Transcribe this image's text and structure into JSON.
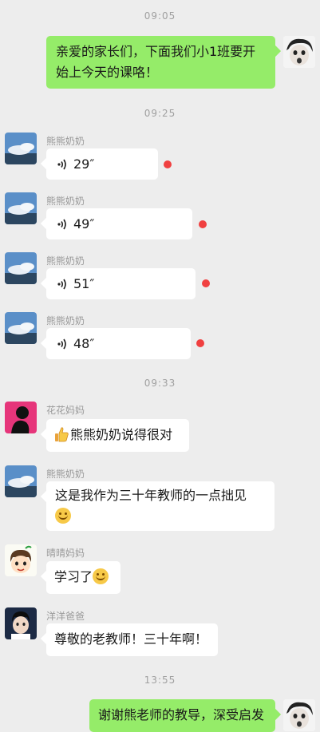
{
  "timestamps": [
    "09:05",
    "09:25",
    "09:33",
    "13:55"
  ],
  "messages": [
    {
      "sender": "",
      "text": "亲爱的家长们，下面我们小1班要开始上今天的课咯！"
    },
    {
      "sender": "熊熊奶奶",
      "duration": "29″"
    },
    {
      "sender": "熊熊奶奶",
      "duration": "49″"
    },
    {
      "sender": "熊熊奶奶",
      "duration": "51″"
    },
    {
      "sender": "熊熊奶奶",
      "duration": "48″"
    },
    {
      "sender": "花花妈妈",
      "text": "熊熊奶奶说得很对"
    },
    {
      "sender": "熊熊奶奶",
      "text": "这是我作为三十年教师的一点拙见"
    },
    {
      "sender": "晴晴妈妈",
      "text": "学习了"
    },
    {
      "sender": "洋洋爸爸",
      "text": "尊敬的老教师！三十年啊！"
    },
    {
      "sender": "",
      "text": "谢谢熊老师的教导，深受启发"
    }
  ],
  "colors": {
    "outgoing_bubble": "#95ec69",
    "incoming_bubble": "#ffffff",
    "unread_dot": "#f04040",
    "background": "#ededed"
  },
  "icons": {
    "voice": "voice-wave-icon",
    "thumbs_up": "thumbs-up-emoji",
    "smile": "smile-emoji"
  }
}
